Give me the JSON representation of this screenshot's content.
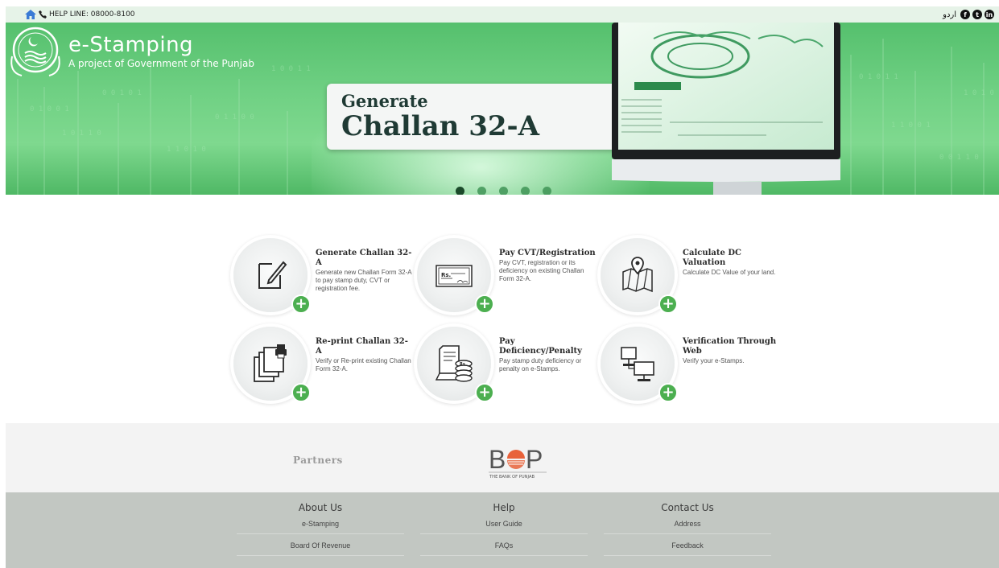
{
  "topbar": {
    "helpline": "HELP LINE: 08000-8100",
    "language": "اردو",
    "social": [
      "facebook-icon",
      "twitter-icon",
      "linkedin-icon"
    ]
  },
  "brand": {
    "title": "e-Stamping",
    "subtitle": "A project of Government of the Punjab"
  },
  "slider": {
    "line1": "Generate",
    "line2": "Challan 32-A",
    "active_index": 0,
    "dot_count": 5
  },
  "services": [
    {
      "title": "Generate Challan 32-A",
      "desc": "Generate new Challan Form 32-A to pay stamp duty, CVT or registration fee.",
      "icon": "edit-form-icon"
    },
    {
      "title": "Pay CVT/Registration",
      "desc": "Pay CVT, registration or its deficiency on existing Challan Form 32-A.",
      "icon": "cheque-icon"
    },
    {
      "title": "Calculate DC Valuation",
      "desc": "Calculate DC Value of your land.",
      "icon": "map-pin-icon"
    },
    {
      "title": "Re-print Challan 32-A",
      "desc": "Verify or Re-print existing Challan Form 32-A.",
      "icon": "print-copy-icon"
    },
    {
      "title": "Pay Deficiency/Penalty",
      "desc": "Pay stamp duty deficiency or penalty on e-Stamps.",
      "icon": "receipt-coins-icon"
    },
    {
      "title": "Verification Through Web",
      "desc": "Verify your e-Stamps.",
      "icon": "computers-icon"
    }
  ],
  "partners": {
    "label": "Partners",
    "bop_text": "THE BANK OF PUNJAB"
  },
  "footer": {
    "about": {
      "title": "About Us",
      "links": [
        "e-Stamping",
        "Board Of Revenue"
      ]
    },
    "help": {
      "title": "Help",
      "links": [
        "User Guide",
        "FAQs"
      ]
    },
    "contact": {
      "title": "Contact Us",
      "links": [
        "Address",
        "Feedback"
      ]
    }
  },
  "colors": {
    "banner_green": "#6fd083",
    "plus_green": "#4caf50",
    "title_dark": "#1f3a34",
    "footer_bg": "#c2c7c2"
  }
}
